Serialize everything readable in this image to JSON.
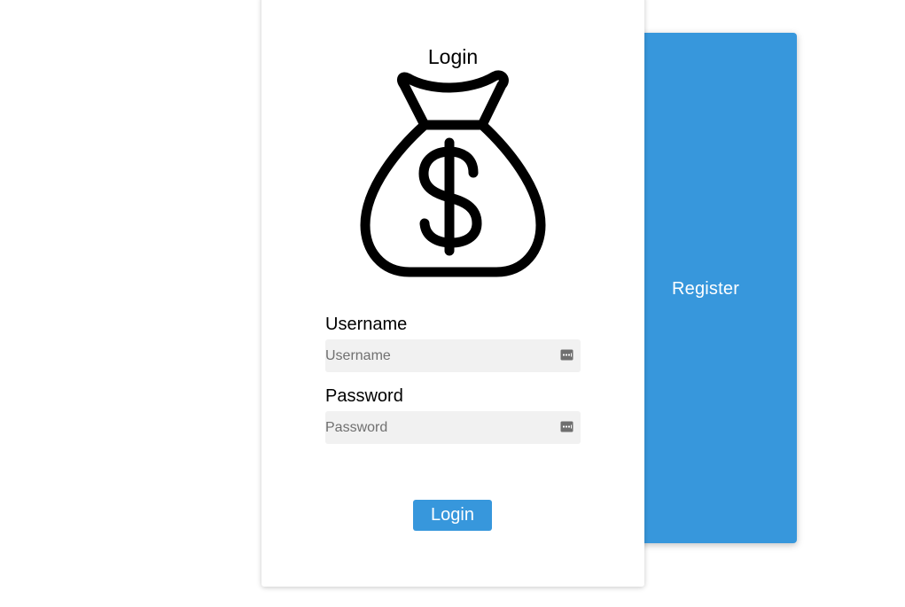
{
  "register": {
    "label": "Register"
  },
  "login_card": {
    "title": "Login",
    "icon": "money-bag-dollar-icon",
    "username": {
      "label": "Username",
      "placeholder": "Username",
      "value": ""
    },
    "password": {
      "label": "Password",
      "placeholder": "Password",
      "value": ""
    },
    "field_icon": "password-manager-key-icon",
    "submit_label": "Login"
  },
  "colors": {
    "accent": "#3797dc",
    "field_bg": "#f1f1f1",
    "text": "#000000",
    "placeholder": "#707070"
  }
}
